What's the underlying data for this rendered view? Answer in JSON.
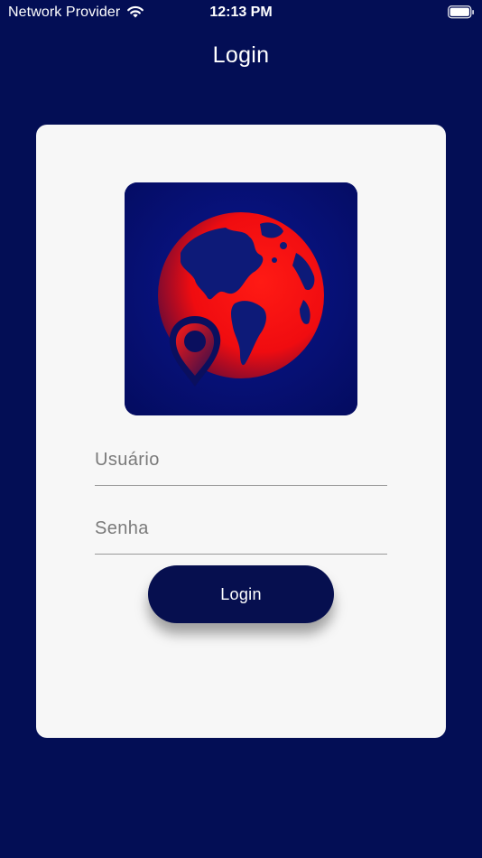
{
  "status_bar": {
    "carrier": "Network Provider",
    "time": "12:13 PM",
    "wifi_icon": "wifi-icon",
    "battery_icon": "battery-icon"
  },
  "nav": {
    "title": "Login"
  },
  "logo": {
    "icon": "globe-location-pin-icon",
    "colors": {
      "background": "#050f6e",
      "globe": "#ff1010",
      "pin": "#0a0f5e"
    }
  },
  "form": {
    "username_placeholder": "Usuário",
    "username_value": "",
    "password_placeholder": "Senha",
    "password_value": "",
    "login_label": "Login"
  },
  "colors": {
    "background": "#030e55",
    "card": "#f7f7f7",
    "button": "#060f4f"
  }
}
